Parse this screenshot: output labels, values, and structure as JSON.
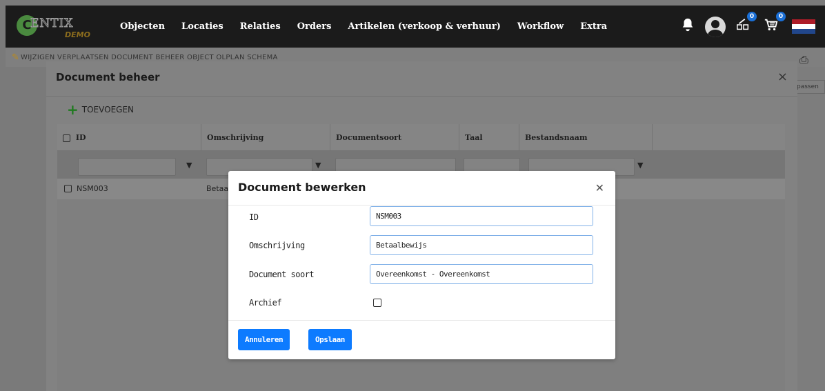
{
  "topbar": {
    "logo": {
      "mark": "C",
      "name": "ENTIX",
      "sub": "DEMO"
    },
    "nav": [
      "Objecten",
      "Locaties",
      "Relaties",
      "Orders",
      "Artikelen (verkoop & verhuur)",
      "Workflow",
      "Extra"
    ],
    "icons": {
      "bell": "bell-icon",
      "user": "user-avatar-icon",
      "cart_edit": {
        "icon": "edit-cart-icon",
        "badge": "0"
      },
      "cart": {
        "icon": "shopping-cart-icon",
        "badge": "0"
      },
      "language": "netherlands-flag-icon"
    },
    "colors": {
      "background": "#1b1b1b",
      "badge": "#1a6fd6"
    }
  },
  "page_toolbar": {
    "text": "WIJZIGEN    VERPLAATSEN    DOCUMENT BEHEER    OBJECT OLPLAN SCHEMA",
    "side_button": "passen"
  },
  "document_beheer": {
    "title": "Document beheer",
    "add_label": "TOEVOEGEN",
    "columns": [
      "ID",
      "Omschrijving",
      "Documentsoort",
      "Taal",
      "Bestandsnaam"
    ],
    "rows": [
      {
        "id": "NSM003",
        "omschrijving": "Betaal"
      }
    ]
  },
  "dialog": {
    "title": "Document bewerken",
    "fields": [
      {
        "label": "ID",
        "value": "NSM003"
      },
      {
        "label": "Omschrijving",
        "value": "Betaalbewijs"
      },
      {
        "label": "Document soort",
        "value": "Overeenkomst - Overeenkomst"
      }
    ],
    "archive_label": "Archief",
    "archive_checked": false,
    "cancel_label": "Annuleren",
    "save_label": "Opslaan",
    "accent": "#0d7bff"
  }
}
